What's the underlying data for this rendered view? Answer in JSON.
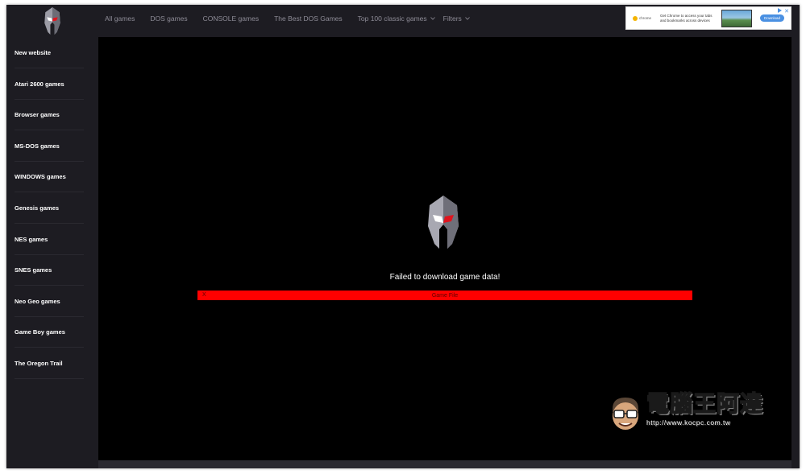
{
  "header": {
    "nav": [
      {
        "label": "All games",
        "has_dropdown": false
      },
      {
        "label": "DOS games",
        "has_dropdown": false
      },
      {
        "label": "CONSOLE games",
        "has_dropdown": false
      },
      {
        "label": "The Best DOS Games",
        "has_dropdown": false
      },
      {
        "label": "Top 100 classic games",
        "has_dropdown": true
      },
      {
        "label": "Filters",
        "has_dropdown": true
      }
    ],
    "logo_icon": "spartan-helmet-icon"
  },
  "ad": {
    "brand": "chrome",
    "text": "Get Chrome to access your tabs and bookmarks across devices",
    "cta": "Download"
  },
  "sidebar": {
    "items": [
      {
        "label": "New website"
      },
      {
        "label": "Atari 2600 games"
      },
      {
        "label": "Browser games"
      },
      {
        "label": "MS-DOS games"
      },
      {
        "label": "WINDOWS games"
      },
      {
        "label": "Genesis games"
      },
      {
        "label": "NES games"
      },
      {
        "label": "SNES games"
      },
      {
        "label": "Neo Geo games"
      },
      {
        "label": "Game Boy games"
      },
      {
        "label": "The Oregon Trail"
      }
    ]
  },
  "main": {
    "message": "Failed to download game data!",
    "error_bar": {
      "close": "X",
      "label": "Game File"
    }
  },
  "watermark": {
    "title": "電腦王阿達",
    "url": "http://www.kocpc.com.tw"
  },
  "colors": {
    "background": "#1d1c22",
    "game_area": "#000000",
    "error_red": "#ff0000",
    "nav_text": "#8e8c97"
  }
}
